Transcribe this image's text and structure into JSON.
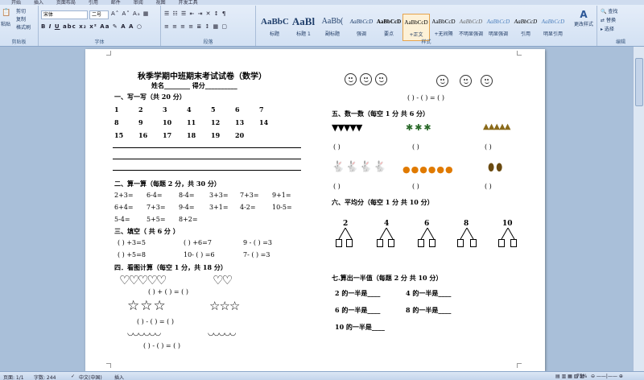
{
  "ribbon": {
    "tabs": [
      "开始",
      "插入",
      "页面布局",
      "引用",
      "邮件",
      "审阅",
      "视图",
      "开发工具"
    ],
    "clipboard": {
      "paste": "粘贴",
      "cut": "剪切",
      "copy": "复制",
      "format_painter": "格式刷",
      "label": "剪贴板"
    },
    "font": {
      "font_name": "宋体",
      "font_size": "二号",
      "label": "字体"
    },
    "paragraph": {
      "label": "段落"
    },
    "styles": {
      "label": "样式",
      "items": [
        {
          "sample": "AaBbC",
          "name": "标题"
        },
        {
          "sample": "AaBl",
          "name": "标题 1"
        },
        {
          "sample": "AaBb(",
          "name": "副标题"
        },
        {
          "sample": "AaBbCcD",
          "name": "强调"
        },
        {
          "sample": "AaBbCcD",
          "name": "要点"
        },
        {
          "sample": "AaBbCcD",
          "name": "+正文"
        },
        {
          "sample": "AaBbCcD",
          "name": "+无间隔"
        },
        {
          "sample": "AaBbCcD",
          "name": "不明显强调"
        },
        {
          "sample": "AaBbCcD",
          "name": "明显强调"
        },
        {
          "sample": "AaBbCcD",
          "name": "引用"
        },
        {
          "sample": "AaBbCcD",
          "name": "明显引用"
        }
      ],
      "change_styles": "更改样式"
    },
    "editing": {
      "find": "查找",
      "replace": "替换",
      "select": "选择",
      "label": "编辑"
    }
  },
  "doc": {
    "title": "秋季学期中班期末考试试卷（数学）",
    "name_line": "姓名________  得分__________",
    "s1": "一、写一写（共 20 分）",
    "s1_numbers": [
      [
        "1",
        "2",
        "3",
        "4",
        "5",
        "6",
        "7"
      ],
      [
        "8",
        "9",
        "10",
        "11",
        "12",
        "13",
        "14"
      ],
      [
        "15",
        "16",
        "17",
        "18",
        "19",
        "20"
      ]
    ],
    "s2": "二、算一算（每题 2 分，共 30 分）",
    "s2_rows": [
      [
        "2+3=",
        "6-4=",
        "8-4=",
        "3+3=",
        "7+3=",
        "9+1="
      ],
      [
        "6+4=",
        "7+3=",
        "9-4=",
        "3+1=",
        "4-2=",
        "10-5="
      ],
      [
        "5-4=",
        "5+5=",
        "8+2="
      ]
    ],
    "s3": "三、填空（ 共 6 分 ）",
    "s3_rows": [
      [
        "(    ) +3=5",
        "(    ) +6=7",
        "9 - (    ) =3"
      ],
      [
        "(    ) +5=8",
        "10- (    ) =6",
        "7- (    ) =3"
      ]
    ],
    "s4": "四．看图计算（每空 1 分，共 18 分）",
    "s4_line1": "(          )        +        (          )        =  (        )",
    "s4_line2": "(          )        -        (          )        =  (        )",
    "s4_line3": "(          )        -        (          )        =  (        )",
    "s5_faces_eq": "(    )  -  (    )   = (    )",
    "s5": "五、数一数（每空 1 分 共 6 分）",
    "paren": "(      )",
    "s6": "六、平均分（每空 1 分   共 10 分）",
    "s6_numbers": [
      "2",
      "4",
      "6",
      "8",
      "10"
    ],
    "s7": "七.算出一半值（每题 2 分 共 10 分）",
    "s7_items": [
      "2 的一半是____",
      "4 的一半是____",
      "6 的一半是____",
      "8 的一半是____",
      "10 的一半是____"
    ]
  },
  "status": {
    "page": "页面: 1/1",
    "words": "字数: 244",
    "lang": "中文(中国)",
    "mode": "插入",
    "zoom": "75%"
  }
}
